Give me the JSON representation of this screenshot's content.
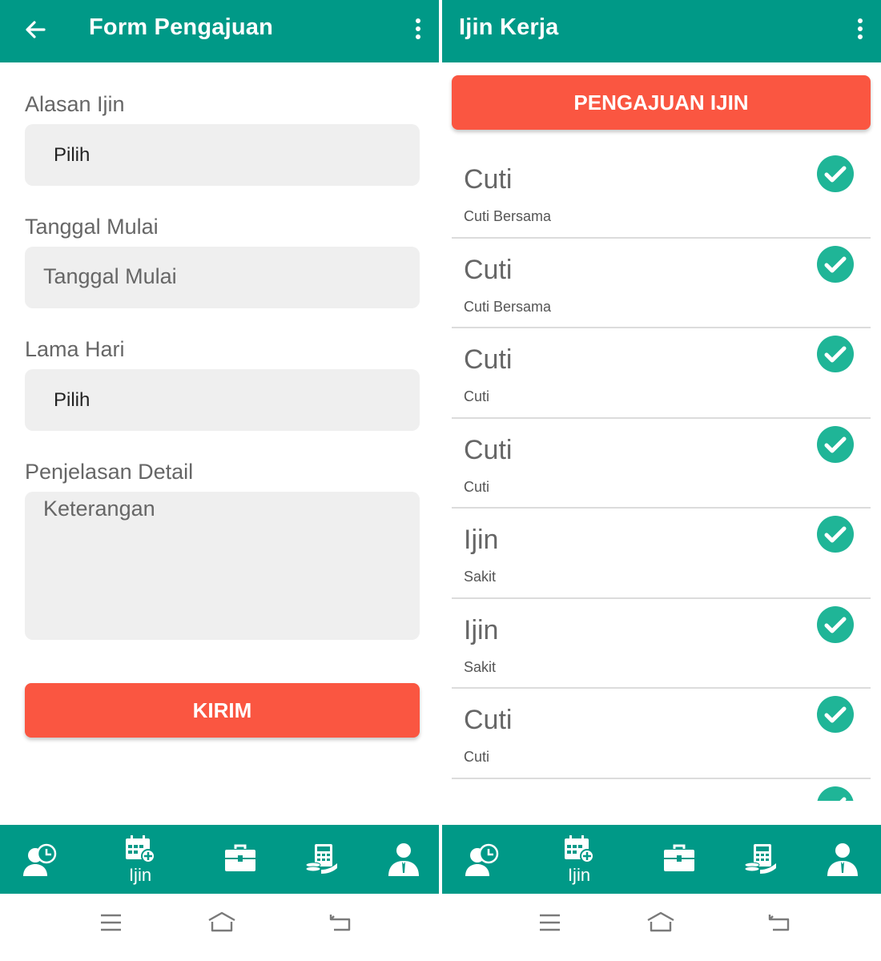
{
  "left": {
    "appbar": {
      "title": "Form Pengajuan"
    },
    "form": {
      "alasan_label": "Alasan Ijin",
      "alasan_value": "Pilih",
      "tanggal_label": "Tanggal Mulai",
      "tanggal_placeholder": "Tanggal Mulai",
      "lama_label": "Lama Hari",
      "lama_value": "Pilih",
      "penjelasan_label": "Penjelasan Detail",
      "penjelasan_placeholder": "Keterangan",
      "submit_label": "KIRIM"
    }
  },
  "right": {
    "appbar": {
      "title": "Ijin Kerja"
    },
    "request_button": "PENGAJUAN IJIN",
    "items": [
      {
        "type": "Cuti",
        "sub": "Cuti Bersama"
      },
      {
        "type": "Cuti",
        "sub": "Cuti Bersama"
      },
      {
        "type": "Cuti",
        "sub": "Cuti"
      },
      {
        "type": "Cuti",
        "sub": "Cuti"
      },
      {
        "type": "Ijin",
        "sub": "Sakit"
      },
      {
        "type": "Ijin",
        "sub": "Sakit"
      },
      {
        "type": "Cuti",
        "sub": "Cuti"
      }
    ]
  },
  "nav": {
    "active_label": "Ijin",
    "items": [
      "attendance-history-icon",
      "calendar-add-icon",
      "briefcase-icon",
      "calculator-money-icon",
      "user-profile-icon"
    ]
  },
  "colors": {
    "primary": "#009987",
    "accent": "#fa5641",
    "check": "#1fb597",
    "field": "#efefef"
  }
}
